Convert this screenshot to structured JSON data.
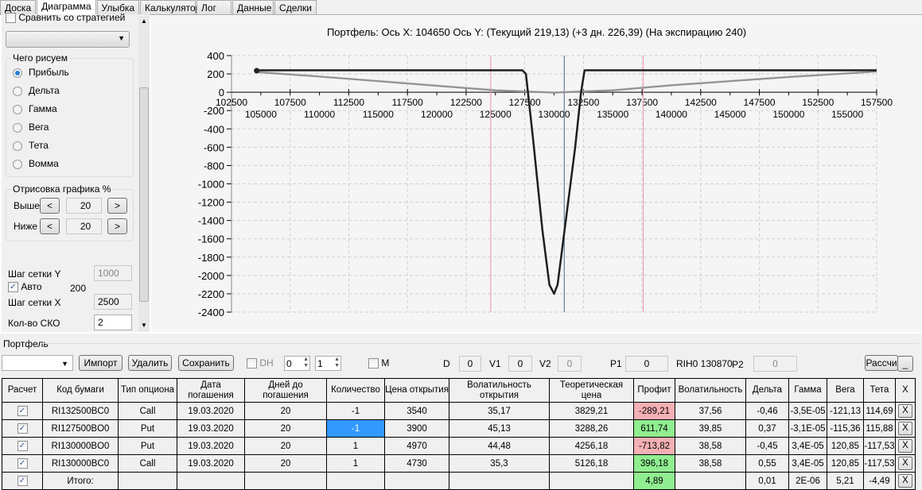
{
  "tabs": [
    "Доска",
    "Диаграмма",
    "Улыбка",
    "Калькулятор",
    "Лог",
    "Данные",
    "Сделки"
  ],
  "left": {
    "compare_label": "Сравнить со стратегией",
    "draw_group": "Чего рисуем",
    "radios": [
      "Прибыль",
      "Дельта",
      "Гамма",
      "Вега",
      "Тета",
      "Вомма"
    ],
    "selected_radio": "Прибыль",
    "render_group": "Отрисовка графика %",
    "above_label": "Выше",
    "above_value": "20",
    "below_label": "Ниже",
    "below_value": "20",
    "btn_left": "<",
    "btn_right": ">",
    "grid_y_label": "Шаг сетки Y",
    "grid_y_value": "1000",
    "auto_label": "Авто",
    "auto_value": "200",
    "grid_x_label": "Шаг сетки X",
    "grid_x_value": "2500",
    "sko_label": "Кол-во СКО",
    "sko_value": "2"
  },
  "chart_data": {
    "type": "line",
    "title": "Портфель: Ось X: 104650 Ось Y:  (Текущий 219,13)  (+3 дн. 226,39)  (На экспирацию 240)",
    "xlim": [
      102500,
      157500
    ],
    "ylim": [
      -2400,
      400
    ],
    "x_ticks_top": [
      "102500",
      "107500",
      "112500",
      "117500",
      "122500",
      "127500",
      "132500",
      "137500",
      "142500",
      "147500",
      "152500",
      "157500"
    ],
    "x_ticks_bottom": [
      "105000",
      "110000",
      "115000",
      "120000",
      "125000",
      "130000",
      "135000",
      "140000",
      "145000",
      "150000",
      "155000"
    ],
    "y_ticks": [
      "400",
      "200",
      "0",
      "-200",
      "-400",
      "-600",
      "-800",
      "-1000",
      "-1200",
      "-1400",
      "-1600",
      "-1800",
      "-2000",
      "-2200",
      "-2400"
    ],
    "grid": true,
    "series": [
      {
        "name": "На экспирацию",
        "color": "#1e1e1e",
        "points": [
          [
            104650,
            240
          ],
          [
            127300,
            240
          ],
          [
            127600,
            200
          ],
          [
            128200,
            -500
          ],
          [
            129000,
            -1500
          ],
          [
            129600,
            -2100
          ],
          [
            130000,
            -2200
          ],
          [
            130300,
            -2100
          ],
          [
            131000,
            -1400
          ],
          [
            131800,
            -600
          ],
          [
            132300,
            0
          ],
          [
            132600,
            240
          ],
          [
            157500,
            240
          ]
        ]
      },
      {
        "name": "Текущий",
        "color": "#909090",
        "points": [
          [
            104650,
            219
          ],
          [
            110000,
            170
          ],
          [
            115000,
            120
          ],
          [
            120000,
            70
          ],
          [
            125000,
            20
          ],
          [
            130000,
            -5
          ],
          [
            135000,
            20
          ],
          [
            140000,
            75
          ],
          [
            145000,
            120
          ],
          [
            150000,
            165
          ],
          [
            157500,
            225
          ]
        ]
      },
      {
        "name": "+3 дн.",
        "color": "#c8c8c8",
        "points": [
          [
            104650,
            226
          ],
          [
            110000,
            175
          ],
          [
            115000,
            125
          ],
          [
            120000,
            75
          ],
          [
            125000,
            25
          ],
          [
            130000,
            0
          ],
          [
            135000,
            25
          ],
          [
            140000,
            80
          ],
          [
            145000,
            125
          ],
          [
            150000,
            170
          ],
          [
            157500,
            230
          ]
        ]
      }
    ],
    "vlines": [
      {
        "x": 124600,
        "color": "#f4a0b0"
      },
      {
        "x": 137600,
        "color": "#f4a0b0"
      },
      {
        "x": 130870,
        "color": "#6a7a9a"
      }
    ]
  },
  "portfolio": {
    "title": "Портфель",
    "import": "Импорт",
    "delete": "Удалить",
    "save": "Сохранить",
    "dh_label": "DH",
    "spin1": "0",
    "spin2": "1",
    "m_label": "M",
    "d_label": "D",
    "d_value": "0",
    "v1_label": "V1",
    "v1_value": "0",
    "v2_label": "V2",
    "v2_value": "0",
    "p1_label": "P1",
    "p1_value": "0",
    "rih_label": "RIH0 130870",
    "p2_label": "P2",
    "p2_value": "0",
    "calc_button": "Рассчи",
    "min_button": "_"
  },
  "table": {
    "headers": [
      "Расчет",
      "Код бумаги",
      "Тип опциона",
      "Дата погашения",
      "Дней до погашения",
      "Количество",
      "Цена открытия",
      "Волатильность открытия",
      "Теоретическая цена",
      "Профит",
      "Волатильность",
      "Дельта",
      "Гамма",
      "Вега",
      "Тета",
      "X"
    ],
    "rows": [
      [
        "RI132500BC0",
        "Call",
        "19.03.2020",
        "20",
        "-1",
        "3540",
        "35,17",
        "3829,21",
        "-289,21",
        "37,56",
        "-0,46",
        "-3,5E-05",
        "-121,13",
        "114,69"
      ],
      [
        "RI127500BO0",
        "Put",
        "19.03.2020",
        "20",
        "-1",
        "3900",
        "45,13",
        "3288,26",
        "611,74",
        "39,85",
        "0,37",
        "-3,1E-05",
        "-115,36",
        "115,88"
      ],
      [
        "RI130000BO0",
        "Put",
        "19.03.2020",
        "20",
        "1",
        "4970",
        "44,48",
        "4256,18",
        "-713,82",
        "38,58",
        "-0,45",
        "3,4E-05",
        "120,85",
        "-117,53"
      ],
      [
        "RI130000BC0",
        "Call",
        "19.03.2020",
        "20",
        "1",
        "4730",
        "35,3",
        "5126,18",
        "396,18",
        "38,58",
        "0,55",
        "3,4E-05",
        "120,85",
        "-117,53"
      ]
    ],
    "total": {
      "label": "Итого:",
      "profit": "4,89",
      "delta": "0,01",
      "gamma": "2E-06",
      "vega": "5,21",
      "theta": "-4,49"
    },
    "delete_btn": "X",
    "colors": {
      "loss": "#f4b0b4",
      "gain": "#90ee90",
      "selected": "#3399ff"
    }
  }
}
